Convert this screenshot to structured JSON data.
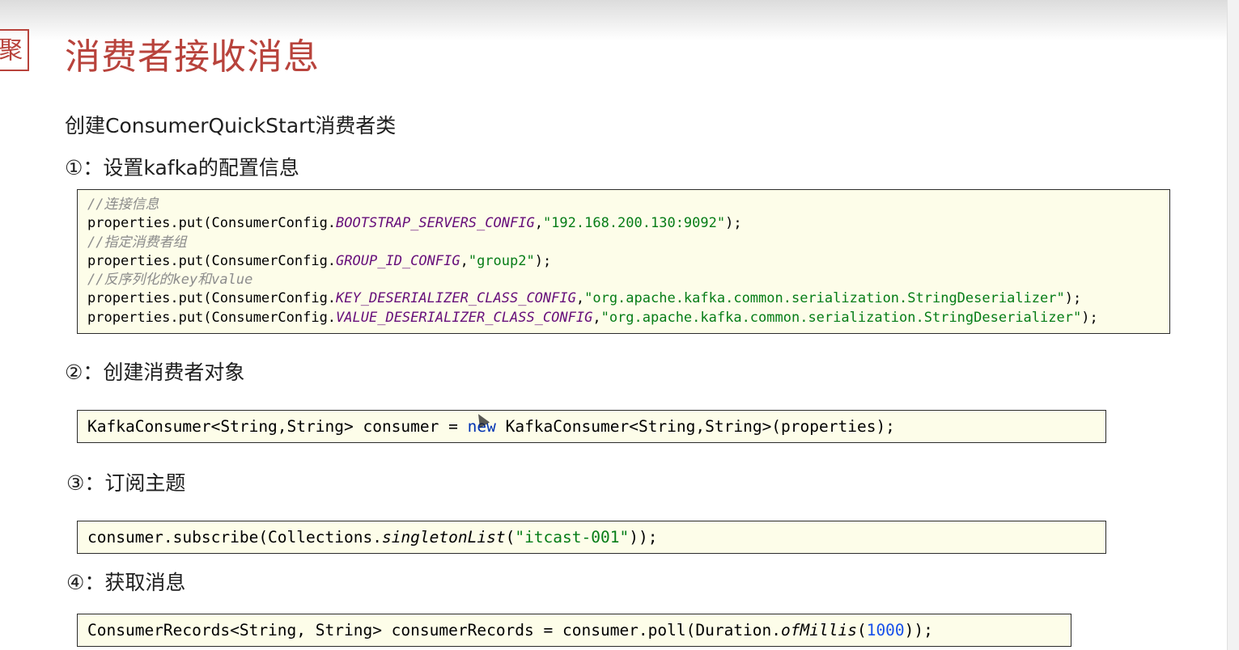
{
  "slide": {
    "side_tag": "聚",
    "title": "消费者接收消息",
    "intro": "创建ConsumerQuickStart消费者类"
  },
  "steps": [
    {
      "heading": "①：设置kafka的配置信息",
      "code_lines": [
        {
          "parts": [
            {
              "t": "//连接信息",
              "c": "comment"
            }
          ]
        },
        {
          "parts": [
            {
              "t": "properties.put(ConsumerConfig.",
              "c": ""
            },
            {
              "t": "BOOTSTRAP_SERVERS_CONFIG",
              "c": "const"
            },
            {
              "t": ",",
              "c": ""
            },
            {
              "t": "\"192.168.200.130:9092\"",
              "c": "str"
            },
            {
              "t": ");",
              "c": ""
            }
          ]
        },
        {
          "parts": [
            {
              "t": "//指定消费者组",
              "c": "comment"
            }
          ]
        },
        {
          "parts": [
            {
              "t": "properties.put(ConsumerConfig.",
              "c": ""
            },
            {
              "t": "GROUP_ID_CONFIG",
              "c": "const"
            },
            {
              "t": ",",
              "c": ""
            },
            {
              "t": "\"group2\"",
              "c": "str"
            },
            {
              "t": ");",
              "c": ""
            }
          ]
        },
        {
          "parts": [
            {
              "t": "//反序列化的key和value",
              "c": "comment"
            }
          ]
        },
        {
          "parts": [
            {
              "t": "properties.put(ConsumerConfig.",
              "c": ""
            },
            {
              "t": "KEY_DESERIALIZER_CLASS_CONFIG",
              "c": "const"
            },
            {
              "t": ",",
              "c": ""
            },
            {
              "t": "\"org.apache.kafka.common.serialization.StringDeserializer\"",
              "c": "str"
            },
            {
              "t": ");",
              "c": ""
            }
          ]
        },
        {
          "parts": [
            {
              "t": "properties.put(ConsumerConfig.",
              "c": ""
            },
            {
              "t": "VALUE_DESERIALIZER_CLASS_CONFIG",
              "c": "const"
            },
            {
              "t": ",",
              "c": ""
            },
            {
              "t": "\"org.apache.kafka.common.serialization.StringDeserializer\"",
              "c": "str"
            },
            {
              "t": ");",
              "c": ""
            }
          ]
        }
      ]
    },
    {
      "heading": "②：创建消费者对象",
      "code_lines": [
        {
          "parts": [
            {
              "t": "KafkaConsumer<String,String> consumer = ",
              "c": ""
            },
            {
              "t": "new",
              "c": "kw"
            },
            {
              "t": " KafkaConsumer<String,String>(properties);",
              "c": ""
            }
          ]
        }
      ]
    },
    {
      "heading": "③：订阅主题",
      "code_lines": [
        {
          "parts": [
            {
              "t": "consumer.subscribe(Collections.",
              "c": ""
            },
            {
              "t": "singletonList",
              "c": "ital"
            },
            {
              "t": "(",
              "c": ""
            },
            {
              "t": "\"itcast-001\"",
              "c": "str"
            },
            {
              "t": "));",
              "c": ""
            }
          ]
        }
      ]
    },
    {
      "heading": "④：获取消息",
      "code_lines": [
        {
          "parts": [
            {
              "t": "ConsumerRecords<String, String> consumerRecords = consumer.poll(Duration.",
              "c": ""
            },
            {
              "t": "ofMillis",
              "c": "ital"
            },
            {
              "t": "(",
              "c": ""
            },
            {
              "t": "1000",
              "c": "num"
            },
            {
              "t": "));",
              "c": ""
            }
          ]
        }
      ]
    }
  ],
  "colors": {
    "title": "#b8433c",
    "code_bg": "#fdfde9",
    "comment": "#8c8c8c",
    "constant": "#660e7a",
    "string": "#067d17",
    "keyword": "#0033b3",
    "number": "#1750eb"
  }
}
